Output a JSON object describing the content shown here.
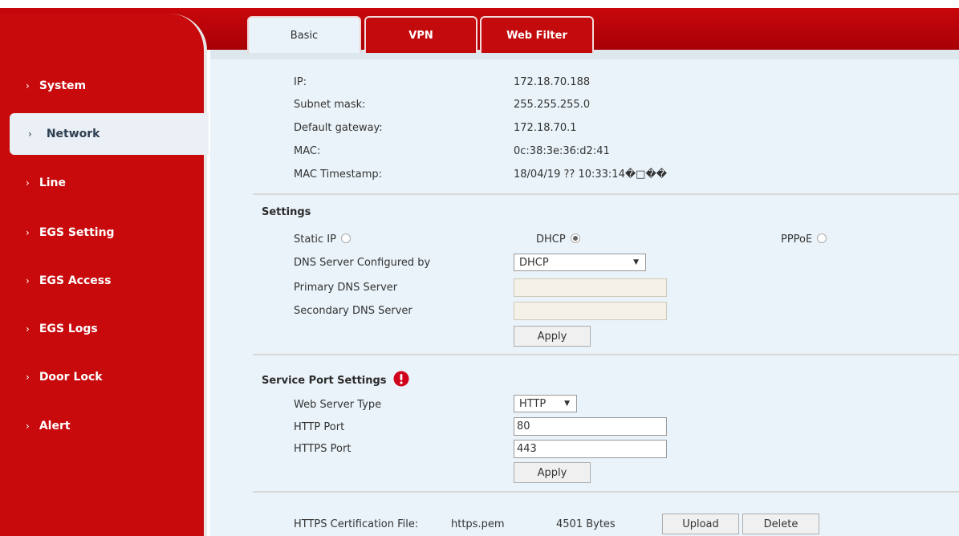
{
  "colors": {
    "brand_red": "#c80a0d",
    "content_bg": "#eaf3f9",
    "active_nav_bg": "#eaf0f5"
  },
  "sidebar": {
    "items": [
      {
        "label": "System",
        "active": false
      },
      {
        "label": "Network",
        "active": true
      },
      {
        "label": "Line",
        "active": false
      },
      {
        "label": "EGS Setting",
        "active": false
      },
      {
        "label": "EGS Access",
        "active": false
      },
      {
        "label": "EGS Logs",
        "active": false
      },
      {
        "label": "Door Lock",
        "active": false
      },
      {
        "label": "Alert",
        "active": false
      }
    ],
    "chevron": "›"
  },
  "tabs": [
    {
      "label": "Basic",
      "active": true
    },
    {
      "label": "VPN",
      "active": false
    },
    {
      "label": "Web Filter",
      "active": false
    }
  ],
  "info": {
    "ip_label": "IP:",
    "ip_value": "172.18.70.188",
    "subnet_label": "Subnet mask:",
    "subnet_value": "255.255.255.0",
    "gateway_label": "Default gateway:",
    "gateway_value": "172.18.70.1",
    "mac_label": "MAC:",
    "mac_value": "0c:38:3e:36:d2:41",
    "mac_ts_label": "MAC Timestamp:",
    "mac_ts_value": "18/04/19 ?? 10:33:14�□��"
  },
  "settings": {
    "title": "Settings",
    "static_ip_label": "Static IP",
    "dhcp_label": "DHCP",
    "pppoe_label": "PPPoE",
    "selected_mode": "DHCP",
    "dns_config_label": "DNS Server Configured by",
    "dns_config_value": "DHCP",
    "primary_dns_label": "Primary DNS Server",
    "primary_dns_value": "",
    "secondary_dns_label": "Secondary DNS Server",
    "secondary_dns_value": "",
    "apply_label": "Apply"
  },
  "service_port": {
    "title": "Service Port Settings",
    "warning_icon": "alert-icon",
    "web_server_type_label": "Web Server Type",
    "web_server_type_value": "HTTP",
    "http_port_label": "HTTP Port",
    "http_port_value": "80",
    "https_port_label": "HTTPS Port",
    "https_port_value": "443",
    "apply_label": "Apply"
  },
  "cert": {
    "label": "HTTPS Certification File:",
    "file_name": "https.pem",
    "file_size": "4501 Bytes",
    "upload_label": "Upload",
    "delete_label": "Delete"
  }
}
